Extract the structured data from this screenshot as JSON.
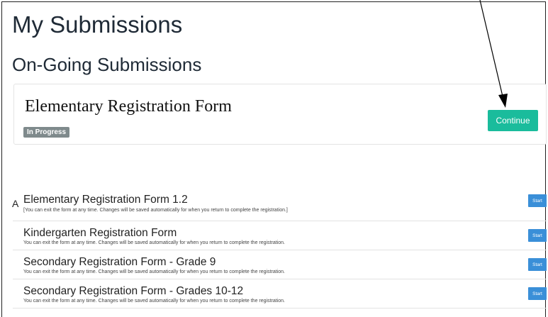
{
  "page": {
    "title": "My Submissions",
    "subtitle": "On-Going Submissions"
  },
  "ongoing": {
    "form_title": "Elementary Registration Form",
    "status_badge": "In Progress",
    "continue_label": "Continue"
  },
  "stray_mark": "A",
  "forms": [
    {
      "name": "Elementary Registration Form 1.2",
      "description": "[You can exit the form at any time. Changes will be saved automatically for when you return to complete the registration.]",
      "start_label": "Start"
    },
    {
      "name": "Kindergarten Registration Form",
      "description": "You can exit the form at any time.  Changes will be saved automatically for when you return to complete the registration.",
      "start_label": "Start"
    },
    {
      "name": "Secondary Registration Form - Grade 9",
      "description": "You can exit the form at any time.  Changes will be saved automatically for when you return to complete the registration.",
      "start_label": "Start"
    },
    {
      "name": "Secondary Registration Form - Grades 10-12",
      "description": "You can exit the form at any time.  Changes will be saved automatically for when you return to complete the registration.",
      "start_label": "Start"
    }
  ],
  "colors": {
    "continue_button": "#1abc9c",
    "start_button": "#3a8fd8",
    "badge": "#7f8a8c",
    "heading_text": "#1f2a36"
  }
}
